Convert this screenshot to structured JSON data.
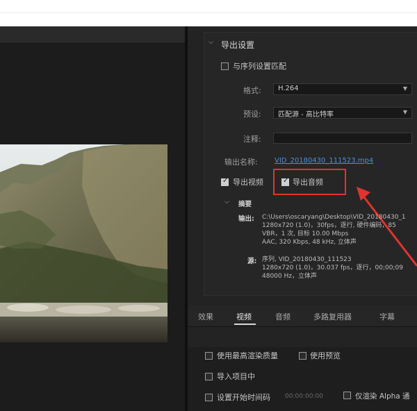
{
  "export_settings": {
    "section_title": "导出设置",
    "match_sequence_label": "与序列设置匹配",
    "format_label": "格式:",
    "format_value": "H.264",
    "preset_label": "预设:",
    "preset_value": "匹配源 - 高比特率",
    "comment_label": "注释:",
    "output_name_label": "输出名称:",
    "output_name_value": "VID_20180430_111523.mp4",
    "export_video_label": "导出视频",
    "export_audio_label": "导出音频"
  },
  "summary": {
    "title": "摘要",
    "output_label": "输出:",
    "output_lines": [
      "C:\\Users\\oscaryang\\Desktop\\VID_20180430_1",
      "1280x720 (1.0)，30fps，逐行, 硬件编码，85",
      "VBR，1 次, 目标 10.00 Mbps",
      "AAC, 320 Kbps, 48  kHz, 立体声"
    ],
    "source_label": "源:",
    "source_lines": [
      "序列, VID_20180430_111523",
      "1280x720 (1.0)，30.037 fps，逐行，00;00;09",
      "48000 Hz，立体声"
    ]
  },
  "tabs": [
    "效果",
    "视频",
    "音频",
    "多路复用器",
    "字幕"
  ],
  "active_tab": "视频",
  "options": {
    "max_render_quality": "使用最高渲染质量",
    "use_previews": "使用预览",
    "import_into_project": "导入项目中",
    "set_start_timecode": "设置开始时间码",
    "start_timecode_value": "00:00:00:00",
    "render_alpha_only": "仅渲染 Alpha 通"
  },
  "checkbox_states": {
    "match_sequence": false,
    "export_video": true,
    "export_audio": true,
    "max_render_quality": false,
    "use_previews": false,
    "import_into_project": false,
    "set_start_timecode": false,
    "render_alpha_only": false
  },
  "colors": {
    "highlight_box": "#e0342e",
    "arrow": "#e0342e",
    "link": "#4c8fd6"
  }
}
